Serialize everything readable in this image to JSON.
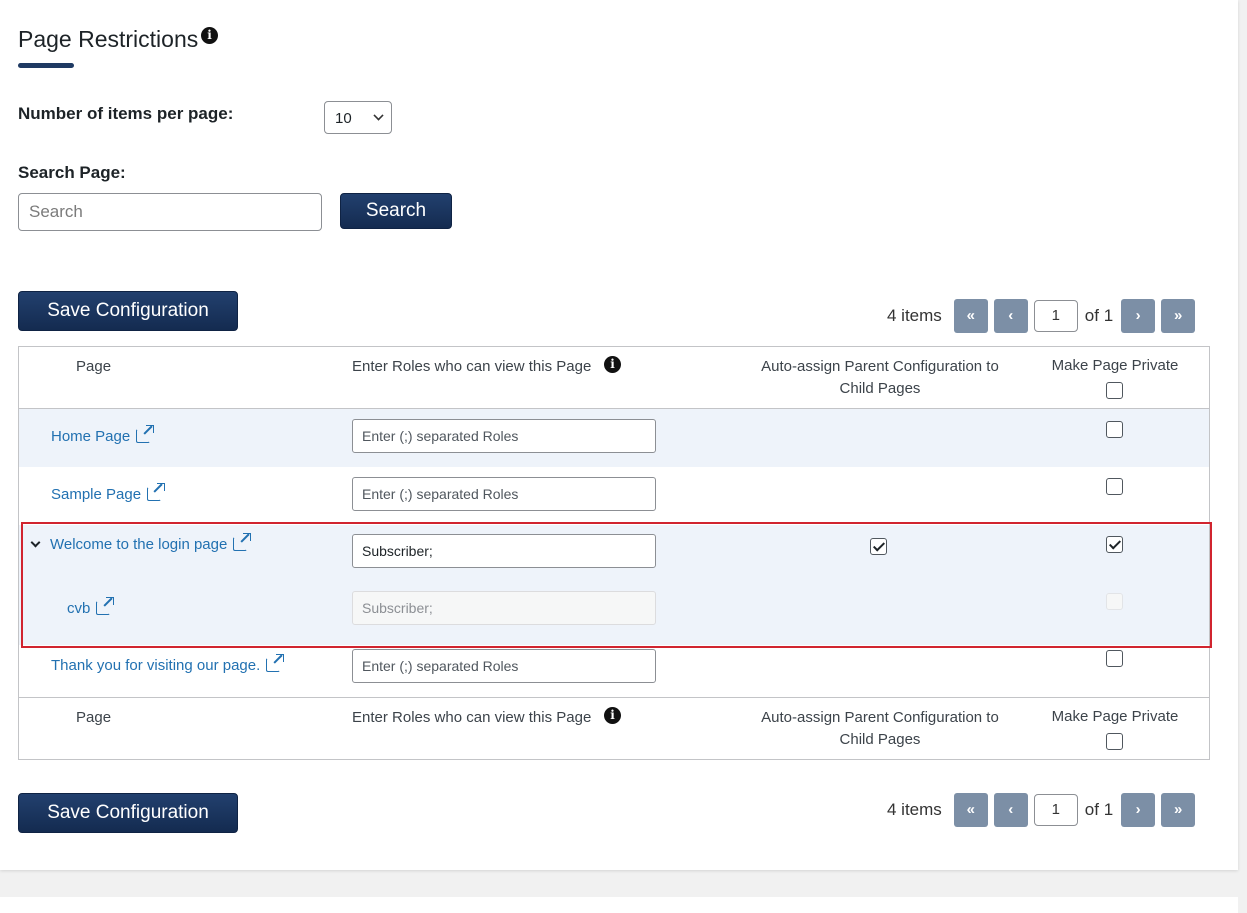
{
  "page_title": "Page Restrictions",
  "info_glyph": "i",
  "items_per_page": {
    "label": "Number of items per page:",
    "value": "10"
  },
  "search": {
    "label": "Search Page:",
    "placeholder": "Search",
    "button": "Search"
  },
  "save_button": "Save Configuration",
  "pagination": {
    "count": "4 items",
    "first": "«",
    "prev": "‹",
    "current": "1",
    "of": "of 1",
    "next": "›",
    "last": "»"
  },
  "columns": {
    "page": "Page",
    "roles": "Enter Roles who can view this Page",
    "auto_assign_line1": "Auto-assign Parent Configuration to",
    "auto_assign_line2": "Child Pages",
    "private": "Make Page Private"
  },
  "roles_placeholder": "Enter (;) separated Roles",
  "rows": [
    {
      "name": "Home Page",
      "roles": "",
      "private": false
    },
    {
      "name": "Sample Page",
      "roles": "",
      "private": false
    },
    {
      "name": "Welcome to the login page",
      "roles": "Subscriber;",
      "auto_assign": true,
      "private": true,
      "expanded": true
    },
    {
      "name": "cvb",
      "roles": "Subscriber;",
      "private": false,
      "disabled": true,
      "child": true
    },
    {
      "name": "Thank you for visiting our page.",
      "roles": "",
      "private": false
    }
  ],
  "colors": {
    "primary": "#1f3a63",
    "link": "#2271b1",
    "highlight_border": "#d1242f",
    "row_alt": "#eef3fa",
    "pager_button": "#7c8fa6"
  },
  "icons": [
    "info-icon",
    "chevron-down-icon",
    "external-link-icon",
    "checkbox-icon",
    "expand-caret-icon"
  ]
}
